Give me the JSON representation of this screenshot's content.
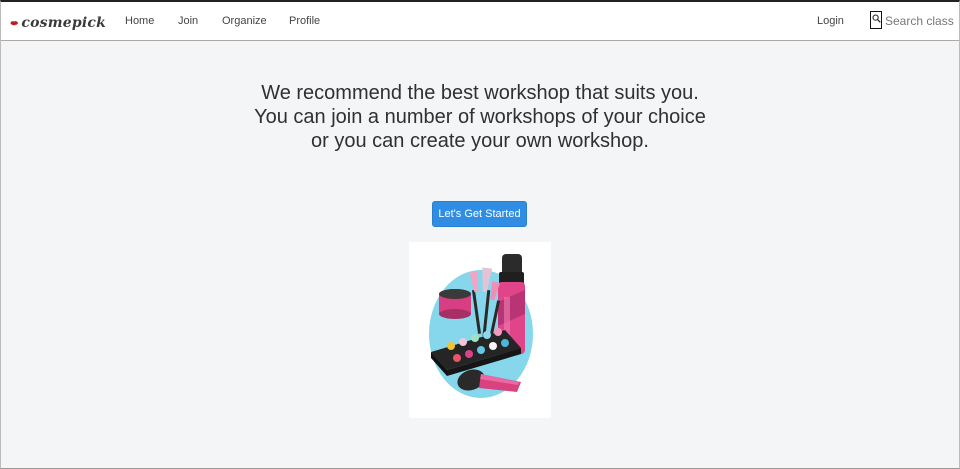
{
  "brand": {
    "name": "cosmepick",
    "logo_icon": "lips-icon",
    "accent": "#c0262f"
  },
  "nav": {
    "links": [
      {
        "label": "Home"
      },
      {
        "label": "Join"
      },
      {
        "label": "Organize"
      },
      {
        "label": "Profile"
      }
    ],
    "login_label": "Login",
    "search": {
      "icon": "search-icon",
      "placeholder": "Search class",
      "value": ""
    }
  },
  "hero": {
    "lines": [
      "We recommend the best workshop that suits you.",
      "You can join a number of workshops of your choice",
      "or you can create your own workshop."
    ],
    "cta_label": "Let's Get Started",
    "cta_color": "#2f8de4",
    "illustration": "makeup-kit-illustration"
  }
}
